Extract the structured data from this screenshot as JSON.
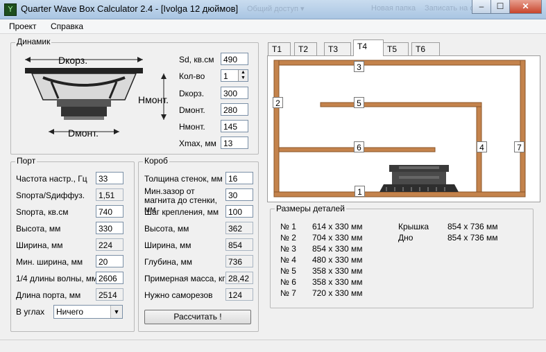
{
  "window": {
    "title": "Quarter Wave Box Calculator 2.4 - [Ivolga 12 дюймов]",
    "ghost_1": "Общий доступ ▾",
    "ghost_2": "Новая папка",
    "ghost_3": "Записать на оптический",
    "minimize_icon": "minimize-icon",
    "maximize_icon": "maximize-icon",
    "close_icon": "close-icon",
    "btn_min": "–",
    "btn_max": "☐",
    "btn_close": "✕"
  },
  "menu": {
    "items": [
      "Проект",
      "Справка"
    ]
  },
  "dinamik": {
    "legend": "Динамик",
    "diagram": {
      "dkorz": "Dкорз.",
      "hmont": "Hмонт.",
      "dmont": "Dмонт."
    },
    "params": [
      {
        "label": "Sd, кв.см",
        "value": "490"
      },
      {
        "label": "Кол-во",
        "value": "1"
      },
      {
        "label": "Dкорз.",
        "value": "300"
      },
      {
        "label": "Dмонт.",
        "value": "280"
      },
      {
        "label": "Hмонт.",
        "value": "145"
      },
      {
        "label": "Xmax, мм",
        "value": "13"
      }
    ]
  },
  "port": {
    "legend": "Порт",
    "rows": [
      {
        "label": "Частота настр., Гц",
        "value": "33",
        "readonly": false
      },
      {
        "label": "Sпорта/Sдиффуз.",
        "value": "1,51",
        "readonly": true
      },
      {
        "label": "Sпорта, кв.см",
        "value": "740",
        "readonly": false
      },
      {
        "label": "Высота, мм",
        "value": "330",
        "readonly": false
      },
      {
        "label": "Ширина, мм",
        "value": "224",
        "readonly": true
      },
      {
        "label": "Мин. ширина, мм",
        "value": "20",
        "readonly": false
      },
      {
        "label": "1/4 длины волны, мм",
        "value": "2606",
        "readonly": false
      },
      {
        "label": "Длина порта, мм",
        "value": "2514",
        "readonly": true
      }
    ],
    "corners_label": "В углах",
    "corners_value": "Ничего"
  },
  "korob": {
    "legend": "Короб",
    "rows": [
      {
        "label": "Толщина стенок, мм",
        "value": "16",
        "readonly": false
      },
      {
        "label": "Мин.зазор от магнита до стенки, мм",
        "value": "30",
        "readonly": false
      },
      {
        "label": "Шаг крепления, мм",
        "value": "100",
        "readonly": false
      },
      {
        "label": "Высота, мм",
        "value": "362",
        "readonly": true
      },
      {
        "label": "Ширина, мм",
        "value": "854",
        "readonly": true
      },
      {
        "label": "Глубина, мм",
        "value": "736",
        "readonly": true
      },
      {
        "label": "Примерная масса, кг",
        "value": "28,42",
        "readonly": true
      },
      {
        "label": "Нужно саморезов",
        "value": "124",
        "readonly": true
      }
    ],
    "calc_button": "Рассчитать !"
  },
  "tabs": [
    "T1",
    "T2",
    "T3",
    "T4",
    "T5",
    "T6"
  ],
  "active_tab": "T4",
  "panel_markers": [
    "1",
    "2",
    "3",
    "4",
    "5",
    "6",
    "7"
  ],
  "details": {
    "legend": "Размеры деталей",
    "items": [
      {
        "name": "№ 1",
        "size": "614 x 330 мм"
      },
      {
        "name": "№ 2",
        "size": "704 x 330 мм"
      },
      {
        "name": "№ 3",
        "size": "854 x 330 мм"
      },
      {
        "name": "№ 4",
        "size": "480 x 330 мм"
      },
      {
        "name": "№ 5",
        "size": "358 x 330 мм"
      },
      {
        "name": "№ 6",
        "size": "358 x 330 мм"
      },
      {
        "name": "№ 7",
        "size": "720 x 330 мм"
      }
    ],
    "extra": [
      {
        "name": "Крышка",
        "size": "854 x 736 мм"
      },
      {
        "name": "Дно",
        "size": "854 x 736 мм"
      }
    ]
  },
  "colors": {
    "board": "#c4834c",
    "board_edge": "#8a5528"
  }
}
